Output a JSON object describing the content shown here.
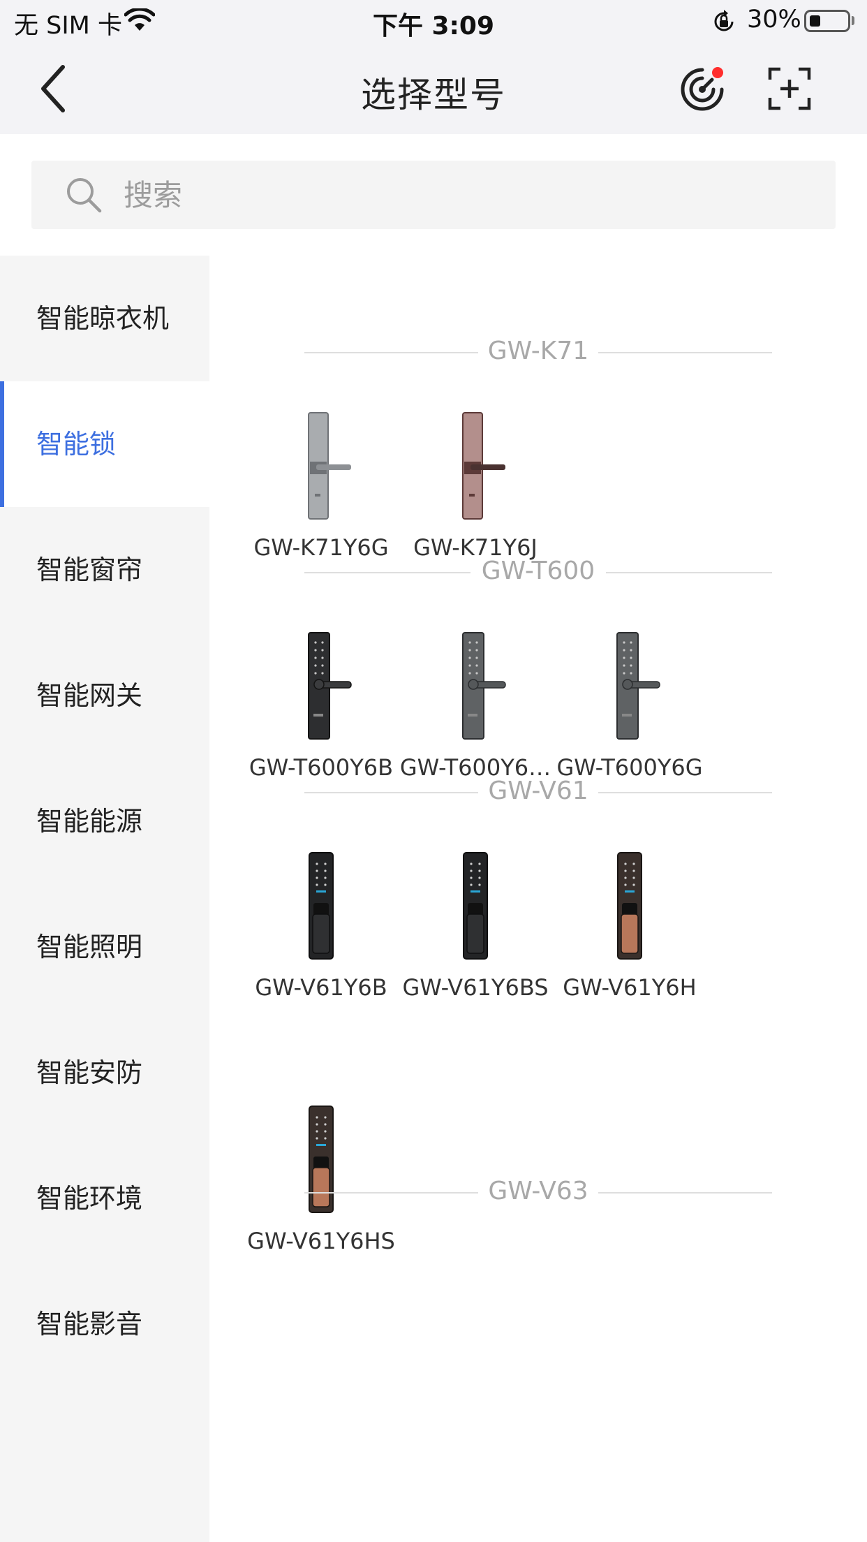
{
  "status_bar": {
    "carrier": "无 SIM 卡",
    "time": "下午 3:09",
    "battery": "30%",
    "battery_level": 0.3
  },
  "nav": {
    "title": "选择型号",
    "back_icon": "chevron-left-icon",
    "radar_icon": "radar-icon",
    "scan_icon": "scan-add-icon",
    "notify_dot_color": "#ff2d2d"
  },
  "search": {
    "placeholder": "搜索",
    "value": ""
  },
  "colors": {
    "accent": "#3d6fe0",
    "sidebar_bg": "#f5f5f5",
    "section_text": "#a8a8a8"
  },
  "categories": [
    {
      "label": "智能晾衣机",
      "active": false
    },
    {
      "label": "智能锁",
      "active": true
    },
    {
      "label": "智能窗帘",
      "active": false
    },
    {
      "label": "智能网关",
      "active": false
    },
    {
      "label": "智能能源",
      "active": false
    },
    {
      "label": "智能照明",
      "active": false
    },
    {
      "label": "智能安防",
      "active": false
    },
    {
      "label": "智能环境",
      "active": false
    },
    {
      "label": "智能影音",
      "active": false
    }
  ],
  "sections": [
    {
      "title": "GW-K71",
      "products": [
        {
          "name": "GW-K71Y6G",
          "style": "k-silver"
        },
        {
          "name": "GW-K71Y6J",
          "style": "k-rose"
        }
      ]
    },
    {
      "title": "GW-T600",
      "products": [
        {
          "name": "GW-T600Y6B",
          "style": "t-black"
        },
        {
          "name": "GW-T600Y6…",
          "style": "t-gray"
        },
        {
          "name": "GW-T600Y6G",
          "style": "t-gray"
        }
      ]
    },
    {
      "title": "GW-V61",
      "products": [
        {
          "name": "GW-V61Y6B",
          "style": "v-black"
        },
        {
          "name": "GW-V61Y6BS",
          "style": "v-black"
        },
        {
          "name": "GW-V61Y6H",
          "style": "v-bronze"
        },
        {
          "name": "GW-V61Y6HS",
          "style": "v-bronze"
        }
      ]
    },
    {
      "title": "GW-V63",
      "products": []
    }
  ]
}
